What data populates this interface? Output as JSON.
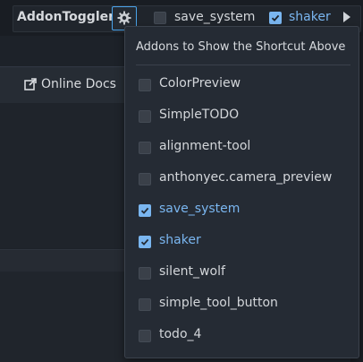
{
  "toolbar": {
    "plugin_title": "AddonToggler",
    "gear_icon": "gear-icon",
    "quick_toggles": [
      {
        "label": "save_system",
        "checked": false
      },
      {
        "label": "shaker",
        "checked": true
      }
    ]
  },
  "background": {
    "online_docs_label": "Online Docs",
    "online_docs_icon": "external-link-icon"
  },
  "popup": {
    "title": "Addons to Show the Shortcut Above",
    "items": [
      {
        "label": "ColorPreview",
        "checked": false
      },
      {
        "label": "SimpleTODO",
        "checked": false
      },
      {
        "label": "alignment-tool",
        "checked": false
      },
      {
        "label": "anthonyec.camera_preview",
        "checked": false
      },
      {
        "label": "save_system",
        "checked": true
      },
      {
        "label": "shaker",
        "checked": true
      },
      {
        "label": "silent_wolf",
        "checked": false
      },
      {
        "label": "simple_tool_button",
        "checked": false
      },
      {
        "label": "todo_4",
        "checked": false
      }
    ]
  },
  "colors": {
    "accent": "#7ab6f0",
    "focus_border": "#4aa3ea",
    "panel_bg": "#252b34"
  }
}
